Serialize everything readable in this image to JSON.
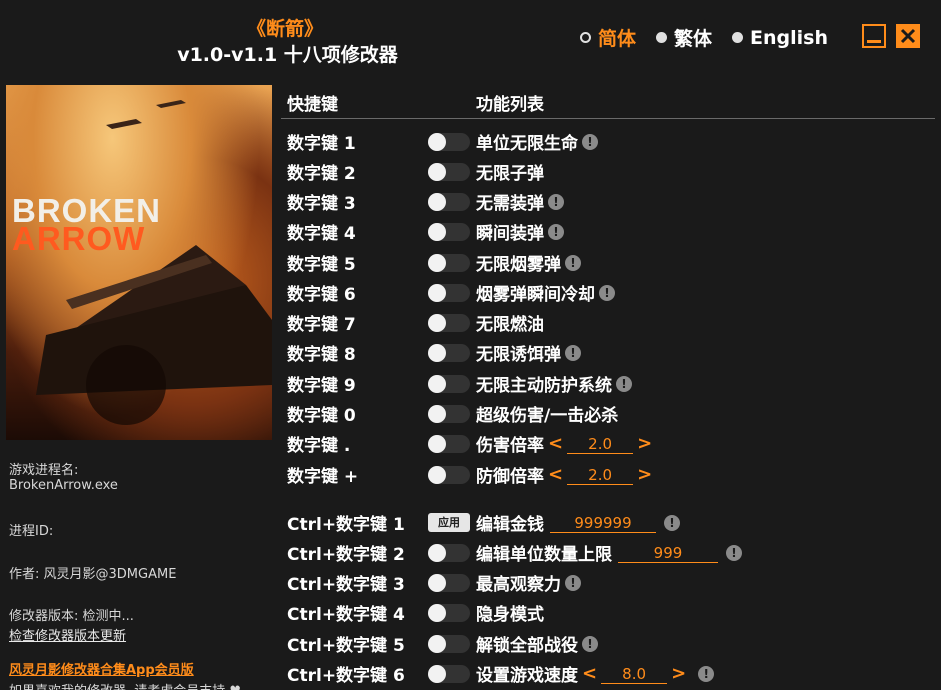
{
  "header": {
    "game_title": "《断箭》",
    "version_title": "v1.0-v1.1 十八项修改器"
  },
  "languages": [
    {
      "label": "简体",
      "selected": true
    },
    {
      "label": "繁体",
      "selected": false
    },
    {
      "label": "English",
      "selected": false
    }
  ],
  "cover": {
    "logo_line1": "BROKEN",
    "logo_line2": "ARROW"
  },
  "info": {
    "process_label": "游戏进程名:",
    "process_value": "BrokenArrow.exe",
    "pid_label": "进程ID:",
    "author": "作者: 风灵月影@3DMGAME",
    "trainer_version": "修改器版本: 检测中...",
    "check_update": "检查修改器版本更新",
    "promo": "风灵月影修改器合集App会员版",
    "support": "如果喜欢我的修改器, 请考虑会员支持 ♥"
  },
  "table": {
    "col_hotkey": "快捷键",
    "col_features": "功能列表"
  },
  "rows": [
    {
      "hotkey": "数字键 1",
      "feature": "单位无限生命"
    },
    {
      "hotkey": "数字键 2",
      "feature": "无限子弹"
    },
    {
      "hotkey": "数字键 3",
      "feature": "无需装弹"
    },
    {
      "hotkey": "数字键 4",
      "feature": "瞬间装弹"
    },
    {
      "hotkey": "数字键 5",
      "feature": "无限烟雾弹"
    },
    {
      "hotkey": "数字键 6",
      "feature": "烟雾弹瞬间冷却"
    },
    {
      "hotkey": "数字键 7",
      "feature": "无限燃油"
    },
    {
      "hotkey": "数字键 8",
      "feature": "无限诱饵弹"
    },
    {
      "hotkey": "数字键 9",
      "feature": "无限主动防护系统"
    },
    {
      "hotkey": "数字键 0",
      "feature": "超级伤害/一击必杀"
    },
    {
      "hotkey": "数字键 .",
      "feature": "伤害倍率",
      "value": "2.0"
    },
    {
      "hotkey": "数字键 +",
      "feature": "防御倍率",
      "value": "2.0"
    },
    {
      "hotkey": "Ctrl+数字键 1",
      "feature": "编辑金钱",
      "value": "999999",
      "apply_label": "应用"
    },
    {
      "hotkey": "Ctrl+数字键 2",
      "feature": "编辑单位数量上限",
      "value": "999"
    },
    {
      "hotkey": "Ctrl+数字键 3",
      "feature": "最高观察力"
    },
    {
      "hotkey": "Ctrl+数字键 4",
      "feature": "隐身模式"
    },
    {
      "hotkey": "Ctrl+数字键 5",
      "feature": "解锁全部战役"
    },
    {
      "hotkey": "Ctrl+数字键 6",
      "feature": "设置游戏速度",
      "value": "8.0"
    }
  ],
  "colors": {
    "accent": "#ff8c1a",
    "background": "#1a1a1a"
  }
}
